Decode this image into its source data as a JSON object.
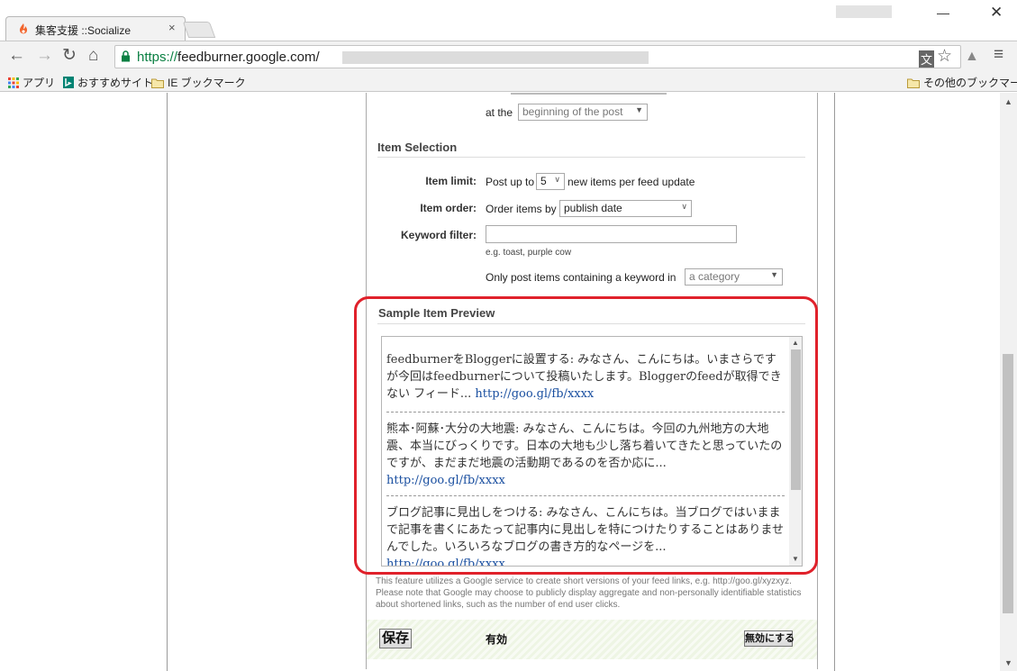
{
  "browser": {
    "tab_title": "集客支援 ::Socialize",
    "tab_close": "×",
    "url_scheme": "https://",
    "url_host": "feedburner.google.com/",
    "window_min": "—",
    "window_close": "✕",
    "nav_back": "←",
    "nav_forward": "→",
    "nav_reload": "↻",
    "nav_home": "⌂",
    "translate_icon": "文",
    "star_icon": "☆",
    "drive_icon": "▲",
    "menu_icon": "≡"
  },
  "bookmarks": {
    "apps": "アプリ",
    "recommended": "おすすめサイト",
    "ie_bookmarks": "IE ブックマーク",
    "other_bookmarks": "その他のブックマーク"
  },
  "form": {
    "position_prefix": "at the",
    "position_value": "beginning of the post",
    "item_selection_title": "Item Selection",
    "item_limit_label": "Item limit:",
    "item_limit_prefix": "Post up to",
    "item_limit_value": "5",
    "item_limit_suffix": "new items per feed update",
    "item_order_label": "Item order:",
    "item_order_prefix": "Order items by",
    "item_order_value": "publish date",
    "keyword_filter_label": "Keyword filter:",
    "keyword_filter_value": "",
    "keyword_hint": "e.g. toast, purple cow",
    "keyword_in_prefix": "Only post items containing a keyword in",
    "keyword_in_value": "a category"
  },
  "preview": {
    "title": "Sample Item Preview",
    "items": [
      {
        "text": "feedburnerをBloggerに設置する: みなさん、こんにちは。いまさらですが今回はfeedburnerについて投稿いたします。Bloggerのfeedが取得できない フィード... ",
        "link": "http://goo.gl/fb/xxxx"
      },
      {
        "text": "熊本･阿蘇･大分の大地震: みなさん、こんにちは。今回の九州地方の大地震、本当にびっくりです。日本の大地も少し落ち着いてきたと思っていたのですが、まだまだ地震の活動期であるのを否か応に... ",
        "link": "http://goo.gl/fb/xxxx"
      },
      {
        "text": "ブログ記事に見出しをつける: みなさん、こんにちは。当ブログではいままで記事を書くにあたって記事内に見出しを特につけたりすることはありませんでした。いろいろなブログの書き方的なページを... ",
        "link": "http://goo.gl/fb/xxxx"
      }
    ]
  },
  "note": "This feature utilizes a Google service to create short versions of your feed links, e.g. http://goo.gl/xyzxyz. Please note that Google may choose to publicly display aggregate and non-personally identifiable statistics about shortened links, such as the number of end user clicks.",
  "footer": {
    "save_label": "保存",
    "status_text": "有効",
    "disable_label": "無効にする"
  },
  "colors": {
    "highlight": "#e0212b",
    "url_scheme": "#0b8043",
    "link": "#1a4fa0"
  }
}
